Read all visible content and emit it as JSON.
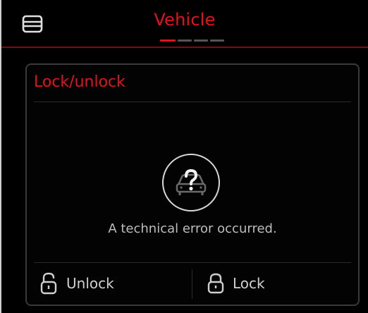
{
  "header": {
    "title": "Vehicle",
    "menu_icon": "menu-icon"
  },
  "colors": {
    "accent": "#e3121d",
    "background": "#000000",
    "text": "#bdbdbd"
  },
  "card": {
    "title": "Lock/unlock",
    "status_icon": "car-question-icon",
    "error_message": "A technical error occurred."
  },
  "actions": {
    "unlock_label": "Unlock",
    "unlock_icon": "unlocked-padlock-icon",
    "lock_label": "Lock",
    "lock_icon": "padlock-icon"
  }
}
